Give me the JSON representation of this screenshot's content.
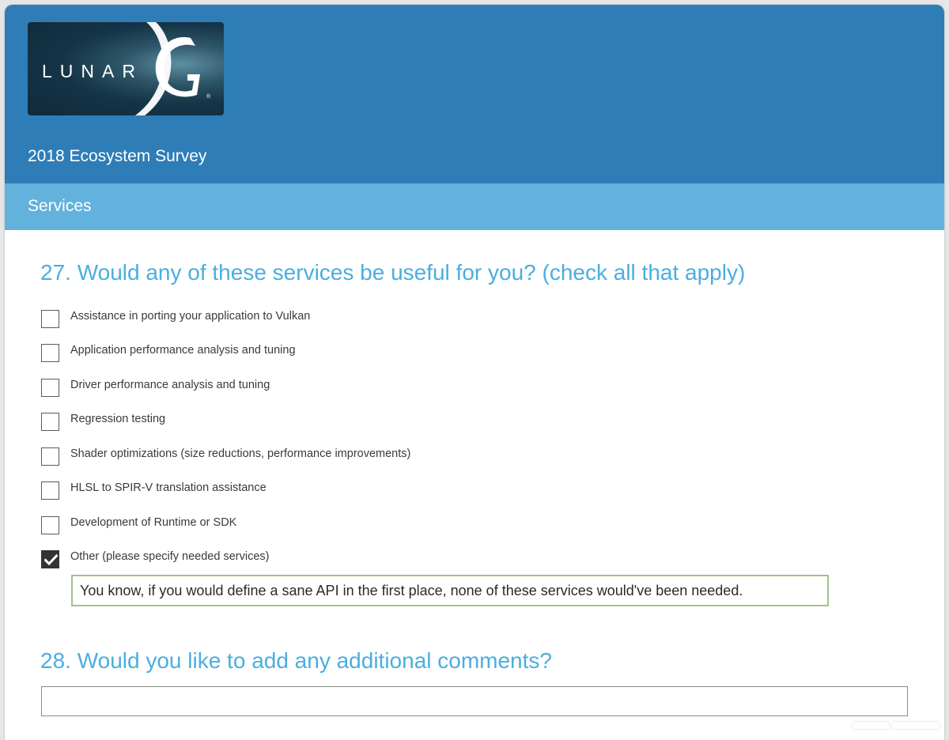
{
  "brand": {
    "logo_text": "LUNAR",
    "logo_letter": "G",
    "logo_mark": "®"
  },
  "header": {
    "survey_title": "2018 Ecosystem Survey"
  },
  "page": {
    "title": "Services"
  },
  "questions": [
    {
      "number": "27",
      "title": "27. Would any of these services be useful for you? (check all that apply)",
      "options": [
        {
          "label": "Assistance in porting your application to Vulkan",
          "checked": false
        },
        {
          "label": "Application performance analysis and tuning",
          "checked": false
        },
        {
          "label": "Driver performance analysis and tuning",
          "checked": false
        },
        {
          "label": "Regression testing",
          "checked": false
        },
        {
          "label": "Shader optimizations (size reductions, performance improvements)",
          "checked": false
        },
        {
          "label": "HLSL to SPIR-V translation assistance",
          "checked": false
        },
        {
          "label": "Development of Runtime or SDK",
          "checked": false
        },
        {
          "label": "Other (please specify needed services)",
          "checked": true
        }
      ],
      "other_value": "You know, if you would define a sane API in the first place, none of these services would've been needed."
    },
    {
      "number": "28",
      "title": "28. Would you like to add any additional comments?",
      "comment_value": ""
    }
  ],
  "colors": {
    "header_bg": "#2e7db7",
    "page_bar_bg": "#62b2dd",
    "question_title": "#4aaee0",
    "other_input_border": "#a3c28a"
  }
}
